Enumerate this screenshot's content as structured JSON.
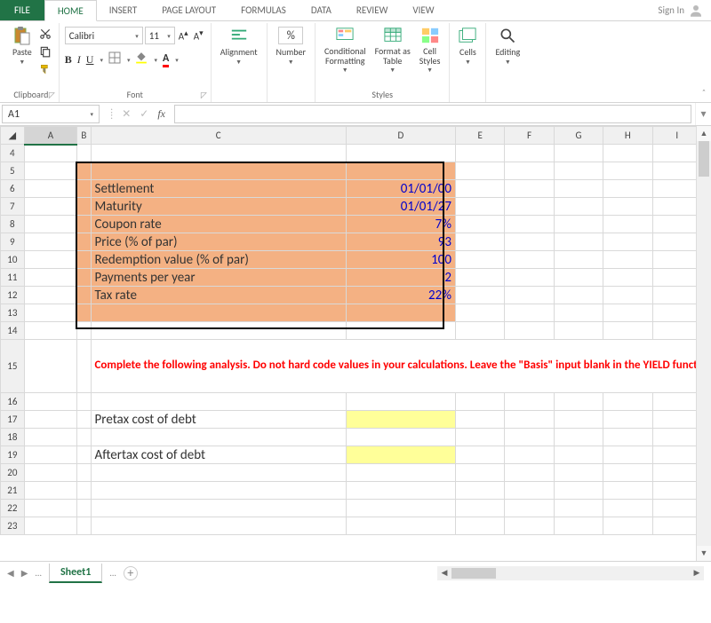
{
  "tabs": {
    "file": "FILE",
    "home": "HOME",
    "insert": "INSERT",
    "page_layout": "PAGE LAYOUT",
    "formulas": "FORMULAS",
    "data": "DATA",
    "review": "REVIEW",
    "view": "VIEW"
  },
  "signin": "Sign In",
  "ribbon": {
    "clipboard": {
      "paste": "Paste",
      "label": "Clipboard"
    },
    "font": {
      "name": "Calibri",
      "size": "11",
      "label": "Font"
    },
    "alignment": {
      "label": "Alignment"
    },
    "number": {
      "label": "Number",
      "percent": "%"
    },
    "styles": {
      "conditional": "Conditional Formatting",
      "format_as": "Format as Table",
      "cell": "Cell Styles",
      "label": "Styles"
    },
    "cells": {
      "label": "Cells"
    },
    "editing": {
      "label": "Editing"
    }
  },
  "namebox": "A1",
  "formula": "",
  "columns": [
    "A",
    "B",
    "C",
    "D",
    "E",
    "F",
    "G",
    "H",
    "I"
  ],
  "rows_start": 4,
  "data_rows": {
    "r6": {
      "label": "Settlement",
      "value": "01/01/00"
    },
    "r7": {
      "label": "Maturity",
      "value": "01/01/27"
    },
    "r8": {
      "label": "Coupon rate",
      "value": "7%"
    },
    "r9": {
      "label": "Price (% of par)",
      "value": "93"
    },
    "r10": {
      "label": "Redemption value (% of par)",
      "value": "100"
    },
    "r11": {
      "label": "Payments per year",
      "value": "2"
    },
    "r12": {
      "label": "Tax rate",
      "value": "22%"
    }
  },
  "instruction": "Complete the following analysis. Do not hard code values in your calculations. Leave the \"Basis\" input blank in the YIELD function. You must use the built-in Excel function to answer this question.",
  "r17_label": "Pretax cost of debt",
  "r19_label": "Aftertax cost of debt",
  "sheet": {
    "name": "Sheet1",
    "ellipsis": "..."
  }
}
